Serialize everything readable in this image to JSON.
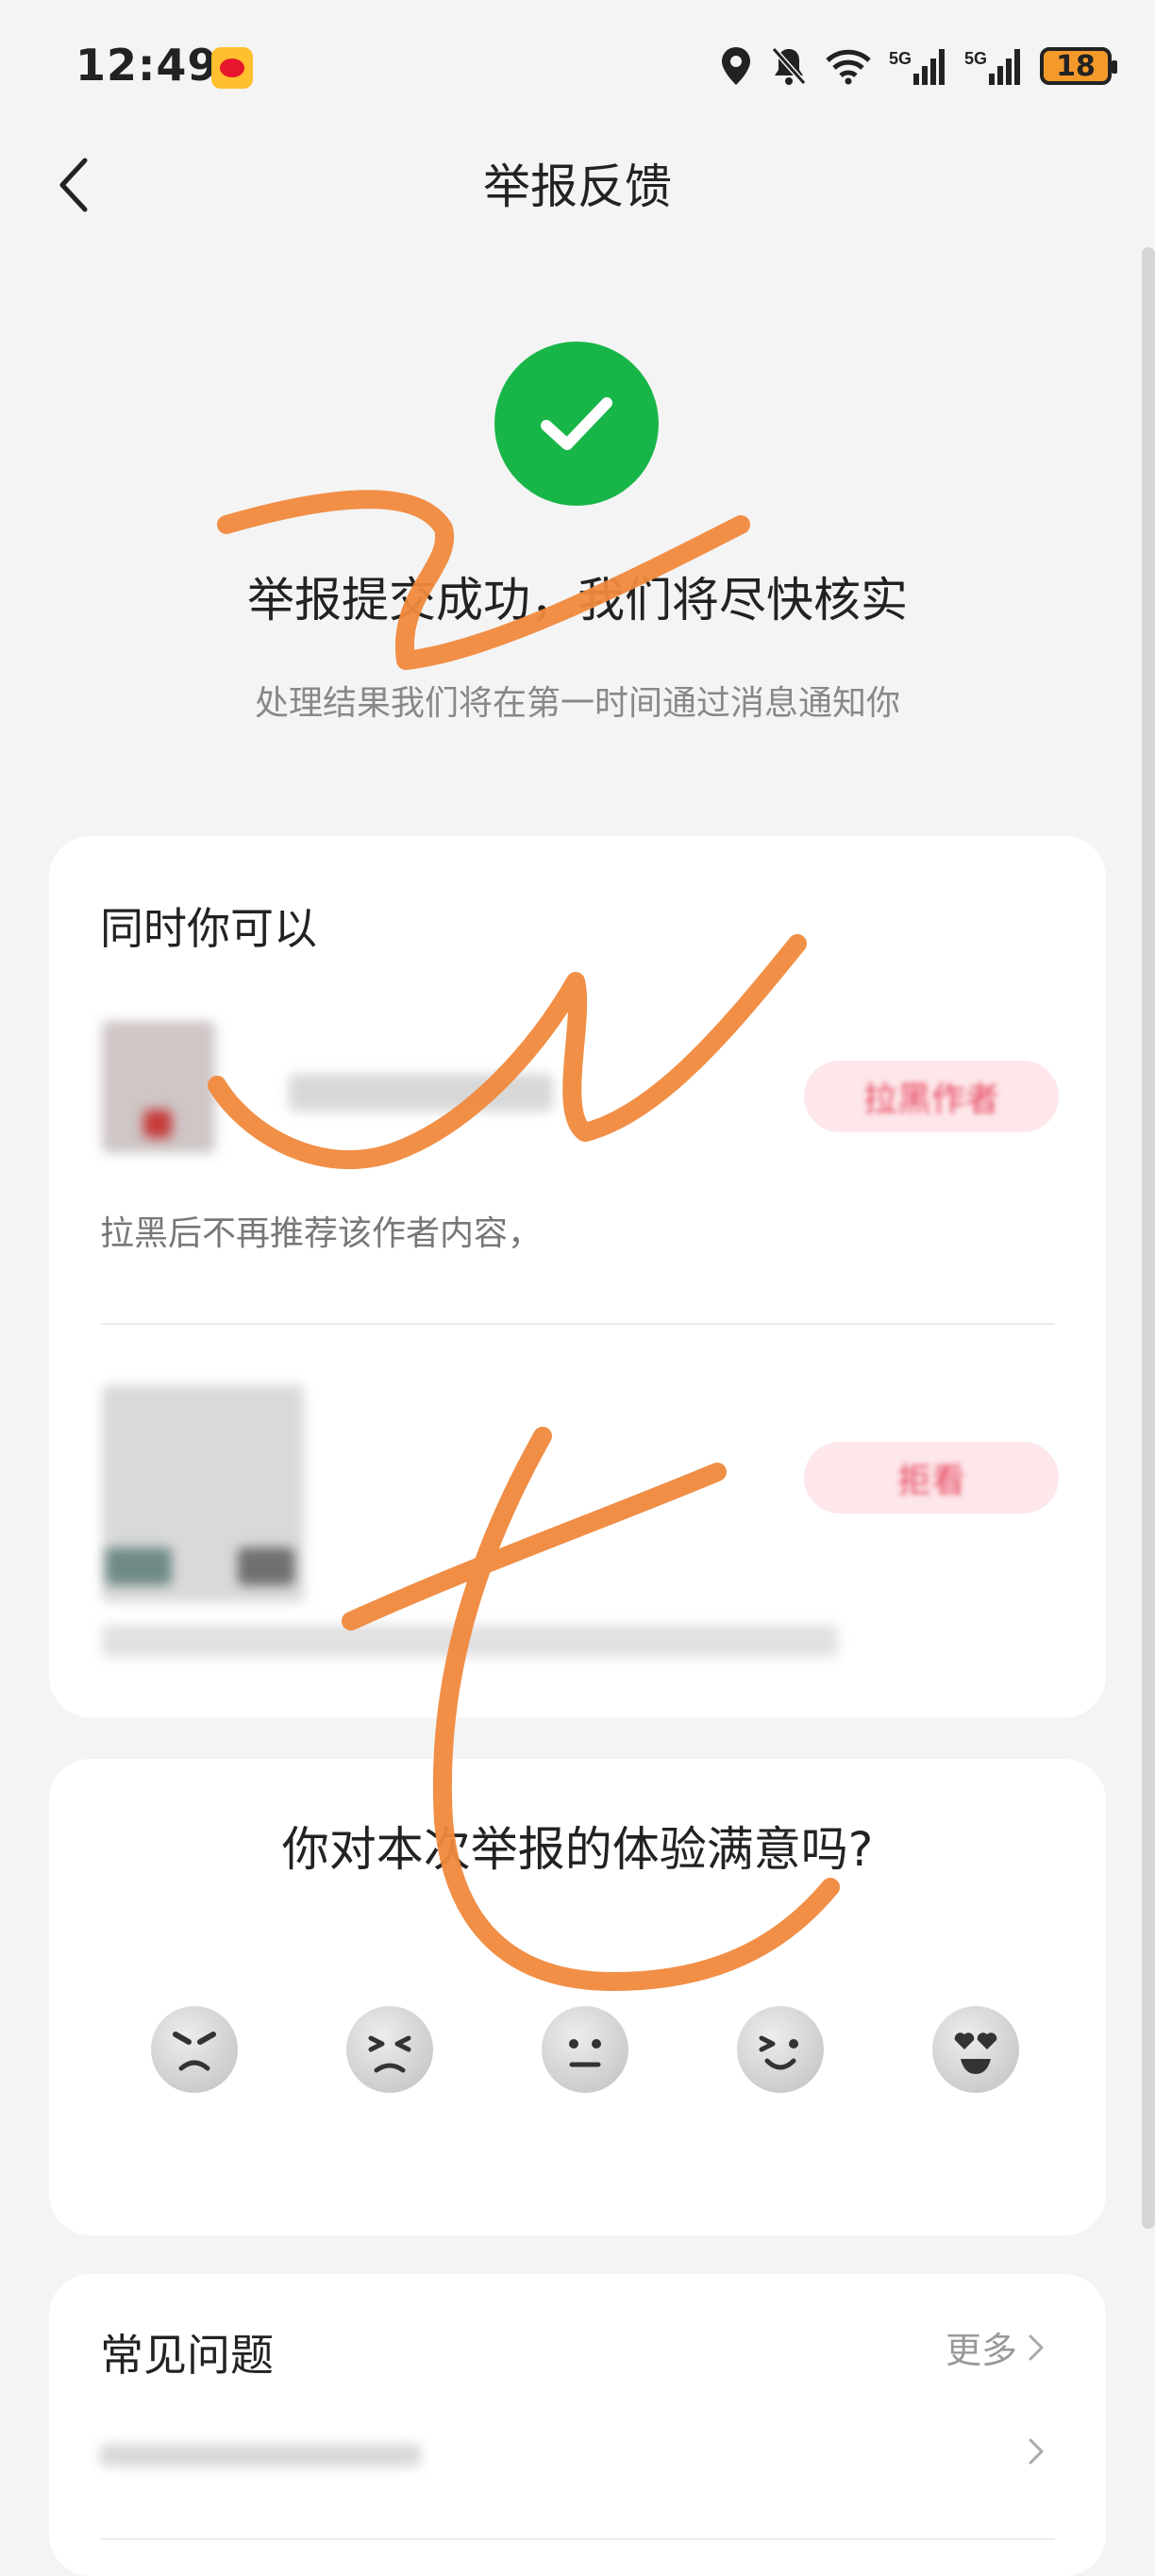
{
  "status_bar": {
    "time": "12:49",
    "battery": "18",
    "network_1": "5G",
    "network_2": "5G"
  },
  "header": {
    "title": "举报反馈"
  },
  "success": {
    "title": "举报提交成功，我们将尽快核实",
    "subtitle": "处理结果我们将在第一时间通过消息通知你",
    "accent": "#18b648"
  },
  "actions": {
    "title": "同时你可以",
    "items": [
      {
        "button": "拉黑作者",
        "desc": "拉黑后不再推荐该作者内容，"
      },
      {
        "button": "拒看",
        "desc": ""
      }
    ]
  },
  "survey": {
    "question": "你对本次举报的体验满意吗?",
    "options": [
      "very-unsatisfied-face-icon",
      "unsatisfied-face-icon",
      "neutral-face-icon",
      "satisfied-face-icon",
      "very-satisfied-face-icon"
    ]
  },
  "faq": {
    "title": "常见问题",
    "more": "更多"
  }
}
